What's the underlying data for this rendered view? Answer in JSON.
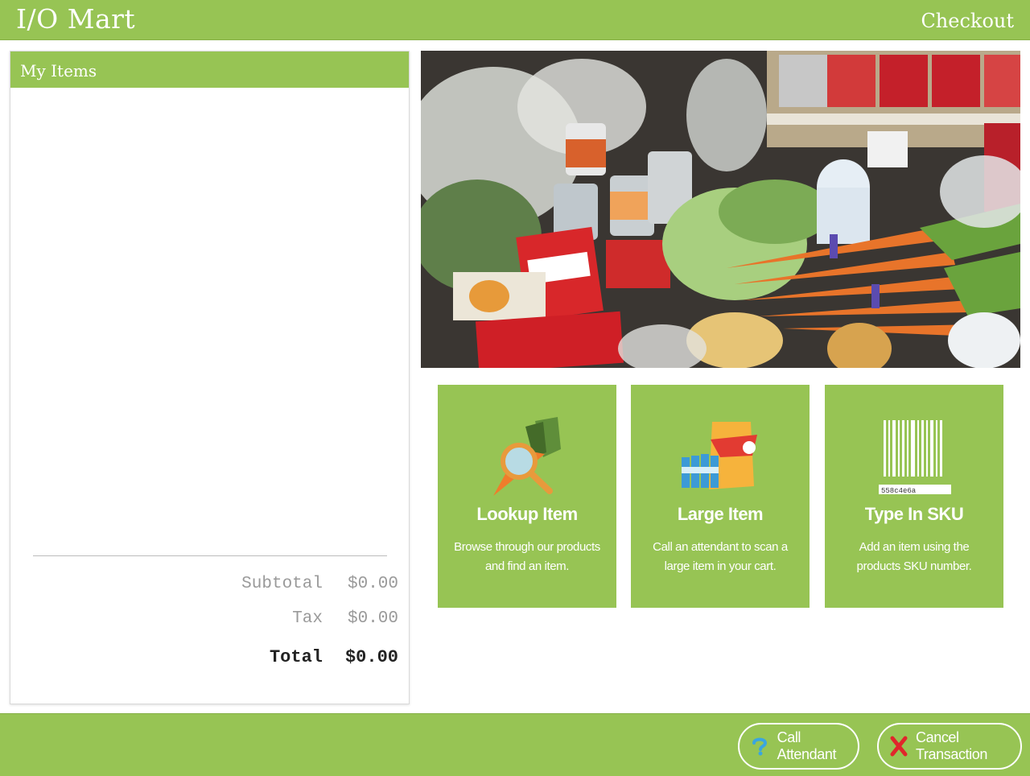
{
  "header": {
    "brand": "I/O Mart",
    "title": "Checkout"
  },
  "items_panel": {
    "title": "My Items",
    "items": [],
    "subtotal_label": "Subtotal",
    "subtotal_value": "$0.00",
    "tax_label": "Tax",
    "tax_value": "$0.00",
    "total_label": "Total",
    "total_value": "$0.00"
  },
  "tiles": [
    {
      "title": "Lookup Item",
      "description": "Browse through our products and find an item.",
      "icon": "carrot-magnifier-icon"
    },
    {
      "title": "Large Item",
      "description": "Call an attendant to scan a large item in your cart.",
      "icon": "large-goods-icon"
    },
    {
      "title": "Type In SKU",
      "description": "Add an item using the products SKU number.",
      "icon": "barcode-icon",
      "sku_sample": "558c4e6a"
    }
  ],
  "footer": {
    "call_attendant_label": "Call Attendant",
    "cancel_transaction_label": "Cancel Transaction"
  },
  "colors": {
    "brand_green": "#97c454",
    "white": "#ffffff",
    "cancel_red": "#e0262b",
    "help_blue": "#3aa6df"
  }
}
